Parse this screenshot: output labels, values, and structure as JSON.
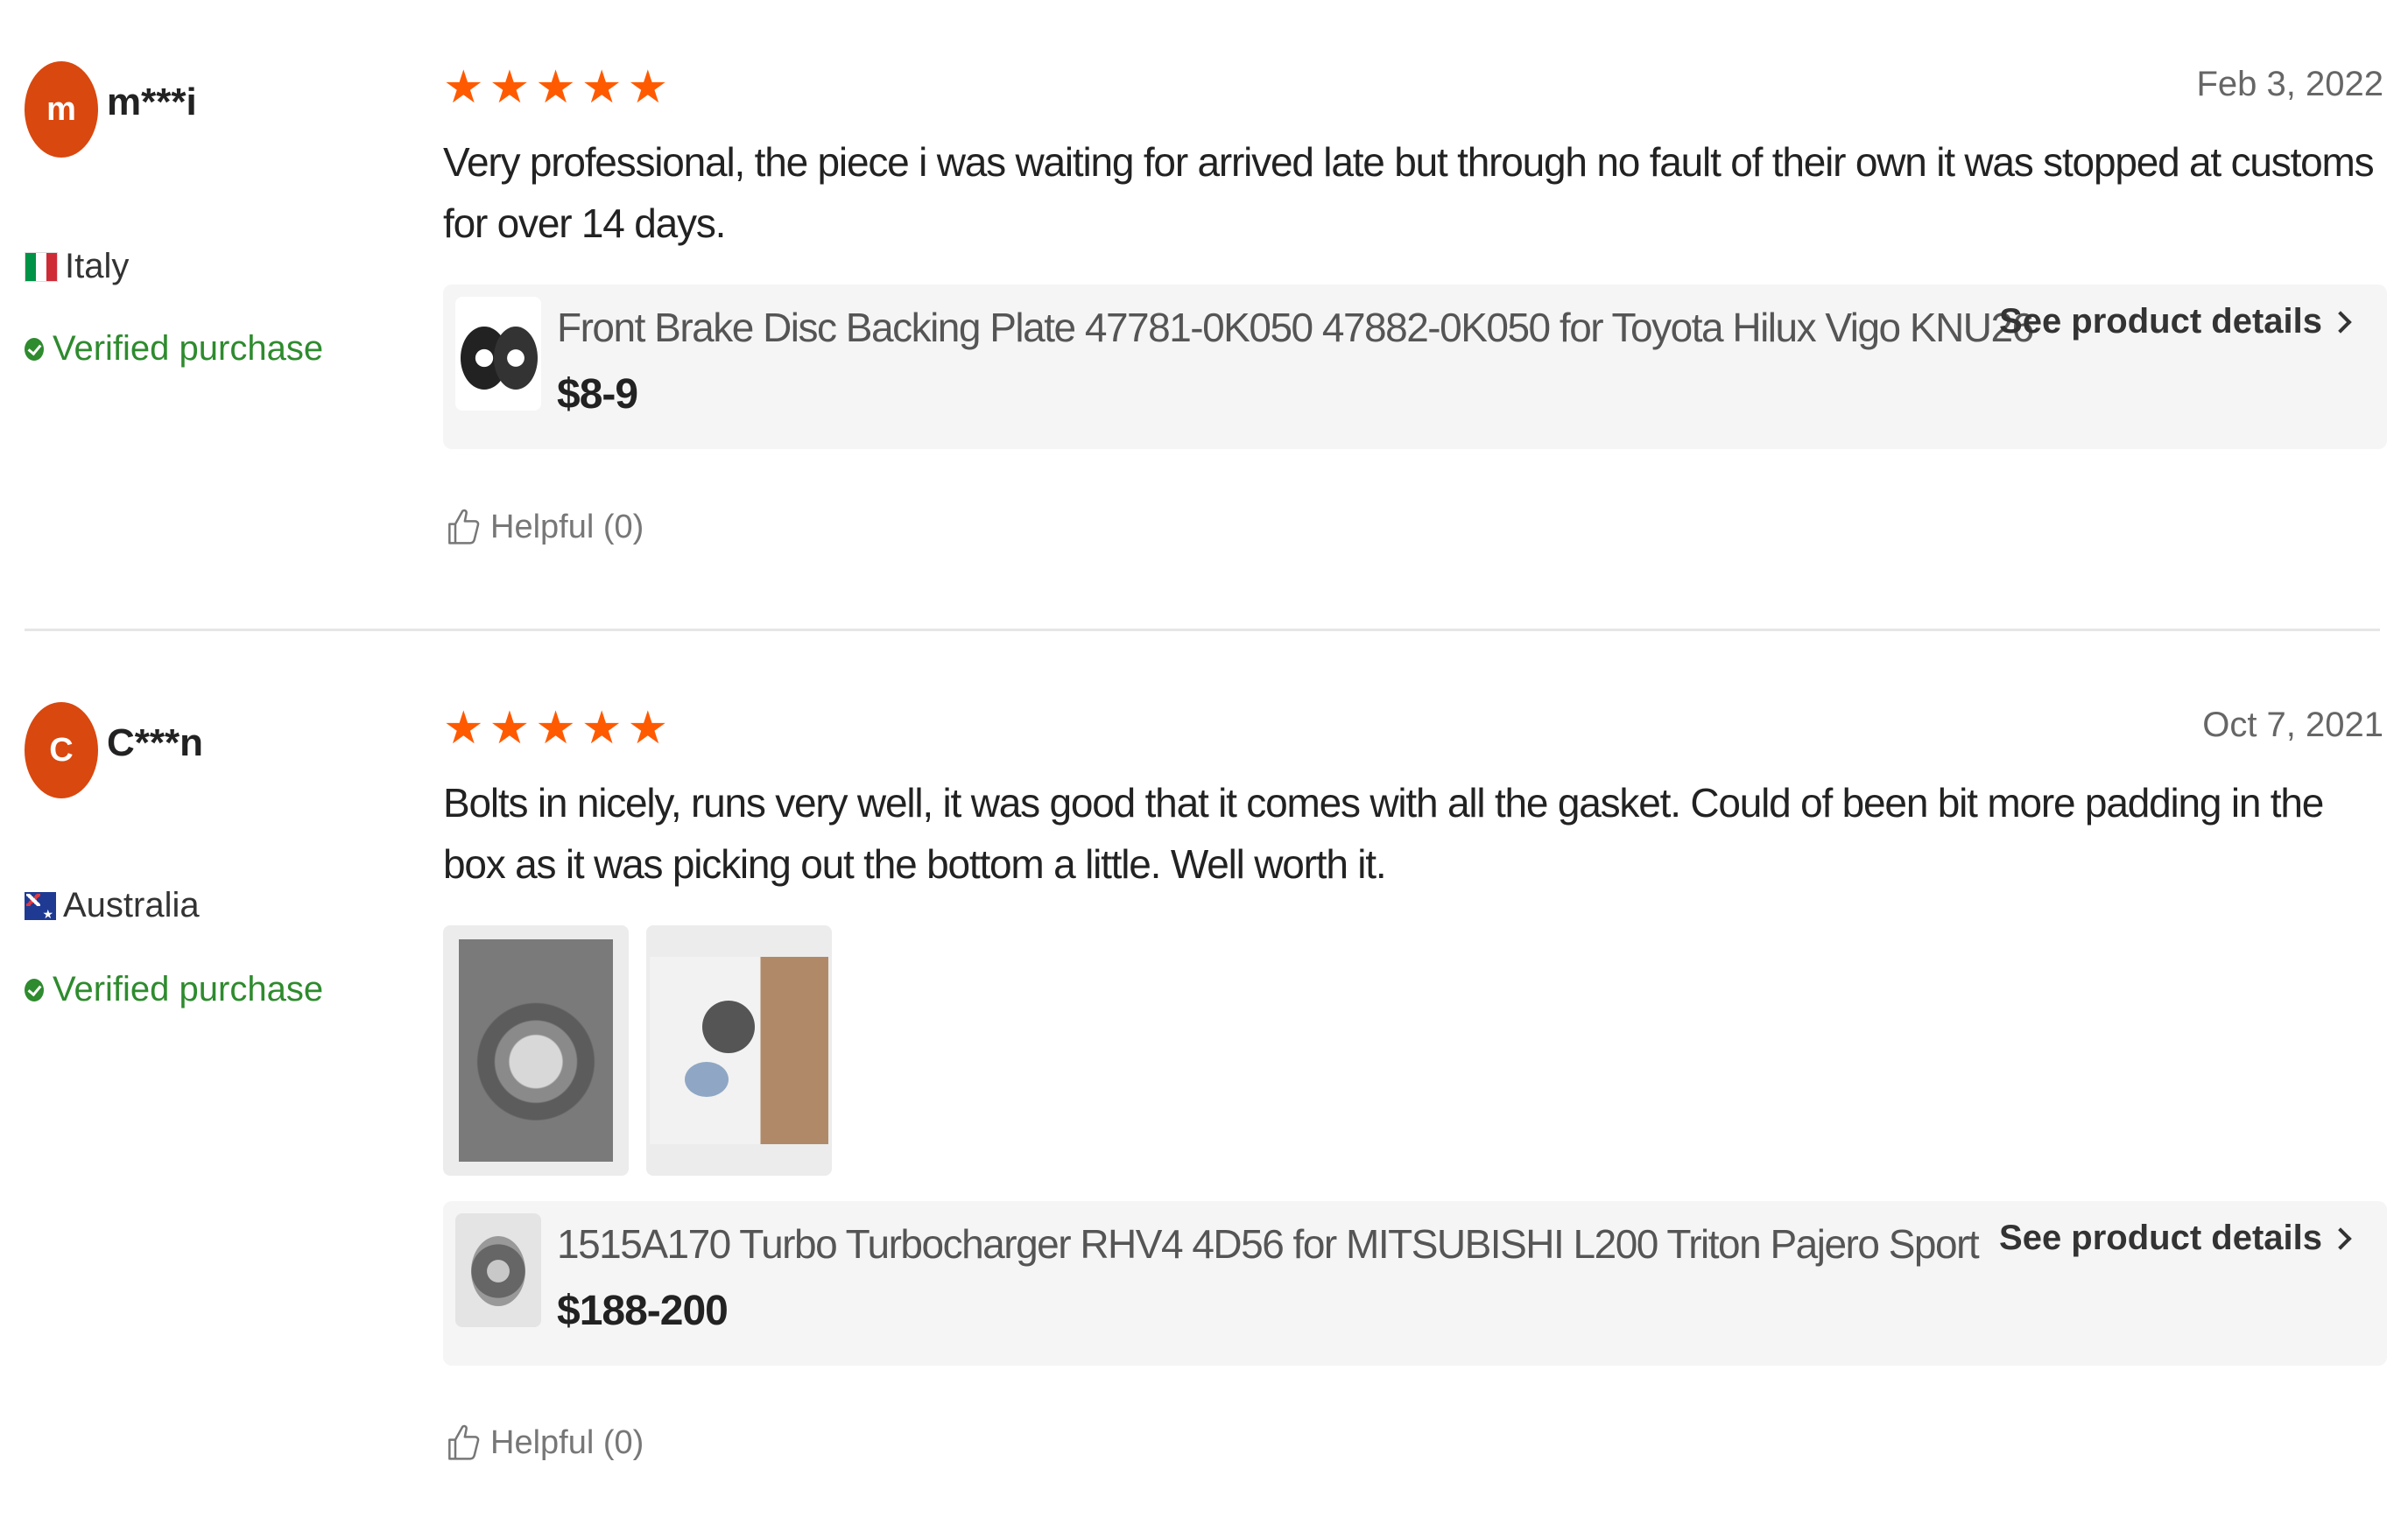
{
  "reviews": [
    {
      "avatar_letter": "m",
      "username": "m***i",
      "country": "Italy",
      "verified_label": "Verified purchase",
      "rating": 5,
      "date": "Feb 3, 2022",
      "text": "Very professional, the piece i was waiting for arrived late but through no fault of their own it was stopped at customs for over 14 days.",
      "product": {
        "title": "Front Brake Disc Backing Plate 47781-0K050 47882-0K050 for Toyota Hilux Vigo KNU26 ...",
        "price": "$8-9",
        "details_label": "See product details"
      },
      "helpful_label": "Helpful (0)"
    },
    {
      "avatar_letter": "C",
      "username": "C***n",
      "country": "Australia",
      "verified_label": "Verified purchase",
      "rating": 5,
      "date": "Oct 7, 2021",
      "text": "Bolts in nicely, runs very well, it was good that it comes with all the gasket. Could of been bit more padding in the box as it was picking out the bottom a little. Well worth it.",
      "photos": [
        "review-photo-1",
        "review-photo-2"
      ],
      "product": {
        "title": "1515A170 Turbo Turbocharger RHV4 4D56 for MITSUBISHI L200 Triton Pajero Sport",
        "price": "$188-200",
        "details_label": "See product details"
      },
      "helpful_label": "Helpful (0)"
    }
  ],
  "colors": {
    "star": "#ff5a00",
    "avatar": "#d9480f",
    "verified": "#2e8b2e",
    "card_bg": "#f5f5f5"
  },
  "icons": [
    "star-icon",
    "check-icon",
    "chevron-right-icon",
    "thumbs-up-icon"
  ]
}
